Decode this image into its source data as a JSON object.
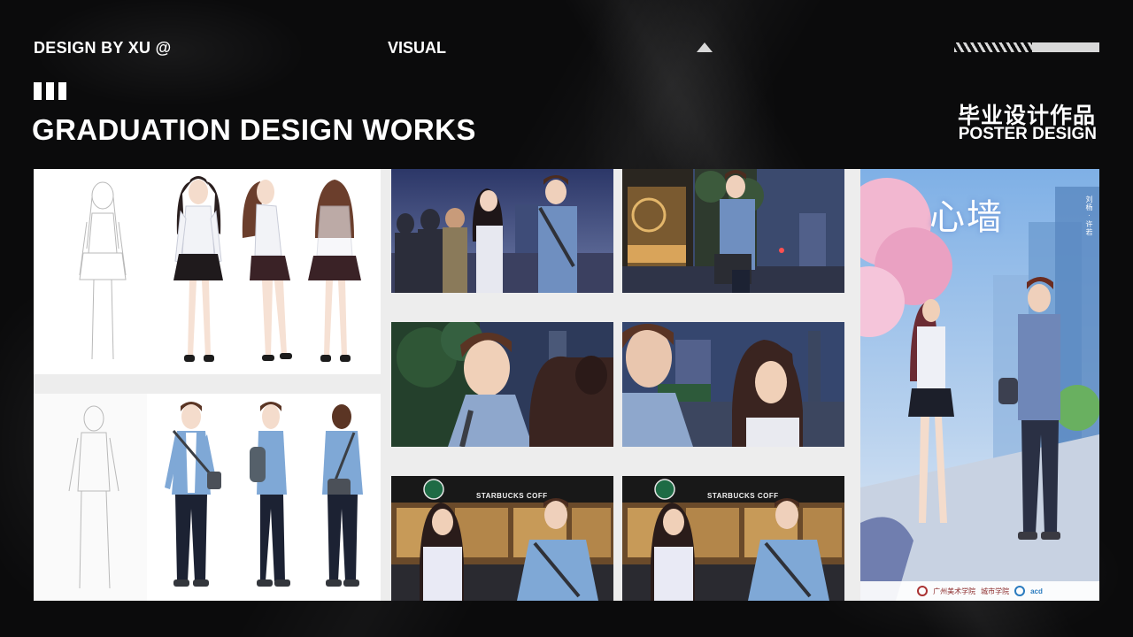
{
  "header": {
    "brand": "DESIGN BY XU  @",
    "section": "VISUAL",
    "title": "GRADUATION DESIGN WORKS",
    "cn_title": "毕业设计作品",
    "subtitle": "POSTER DESIGN"
  },
  "gallery": {
    "scene_5_sign": "STARBUCKS COFF",
    "scene_6_sign": "STARBUCKS COFF",
    "poster": {
      "title": "心墙",
      "side_text": "刘杨 · 许若",
      "footer_school": "广州美术学院",
      "footer_dept": "城市学院",
      "footer_acd": "acd"
    }
  },
  "colors": {
    "background": "#0b0b0c",
    "text": "#ffffff",
    "accent_light": "#d8d8d8",
    "gallery_bg": "#ededed"
  },
  "icons": [
    "triangle-up-icon",
    "stripe-bar-icon",
    "three-bars-icon"
  ]
}
